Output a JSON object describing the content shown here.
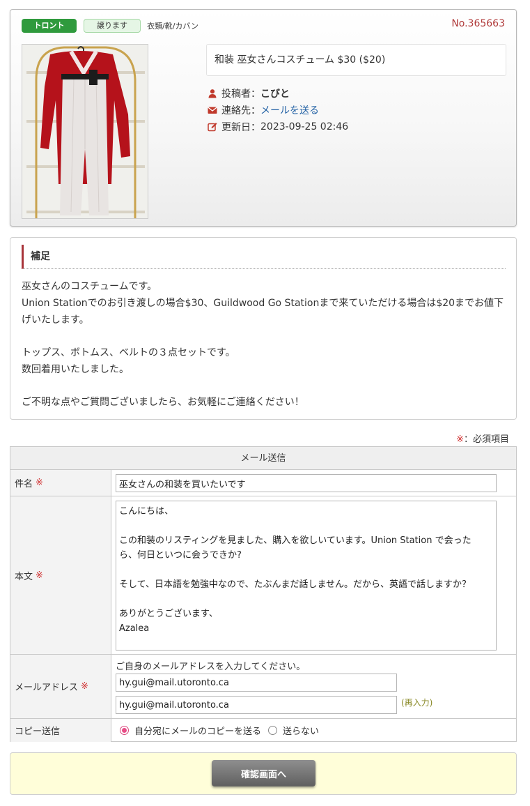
{
  "listing": {
    "city_tag": "トロント",
    "type_tag": "譲ります",
    "category": "衣類/靴/カバン",
    "number": "No.365663",
    "title": "和装 巫女さんコスチューム $30 ($20)",
    "poster_label": "投稿者：",
    "poster": "こびと",
    "contact_label": "連絡先：",
    "contact_link": "メールを送る",
    "updated_label": "更新日：",
    "updated": "2023-09-25 02:46",
    "icons": {
      "poster": "user-icon",
      "contact": "envelope-icon",
      "updated": "edit-icon"
    },
    "colors": {
      "city_tag": "#2f9a3d",
      "number": "#b03a3a",
      "icon": "#c0392b"
    }
  },
  "notes": {
    "heading": "補足",
    "lines": [
      "巫女さんのコスチュームです。",
      "Union Stationでのお引き渡しの場合$30、Guildwood Go Stationまで来ていただける場合は$20までお値下",
      "げいたします。",
      "トップス、ボトムス、ベルトの３点セットです。",
      "数回着用いたしました。",
      "ご不明な点やご質問ございましたら、お気軽にご連絡ください！"
    ]
  },
  "form": {
    "required_mark": "※",
    "required_text": "：必須項目",
    "heading": "メール送信",
    "subject_label": "件名",
    "subject_value": "巫女さんの和装を買いたいです",
    "body_label": "本文",
    "body_value": "こんにちは、\n\nこの和装のリスティングを見ました、購入を欲しいています。Union Station で会った\nら、何日といつに会うできか?\n\nそして、日本語を勉強中なので、たぶんまだ話しません。だから、英語で話しますか？\n\nありがとうございます、\nAzalea",
    "email_label": "メールアドレス",
    "email_hint": "ご自身のメールアドレスを入力してください。",
    "email_value": "hy.gui@mail.utoronto.ca",
    "email_confirm_value": "hy.gui@mail.utoronto.ca",
    "email_reenter": "(再入力)",
    "copy_label": "コピー送信",
    "copy_options": [
      "自分宛にメールのコピーを送る",
      "送らない"
    ],
    "copy_selected": "自分宛にメールのコピーを送る"
  },
  "submit_label": "確認画面へ"
}
